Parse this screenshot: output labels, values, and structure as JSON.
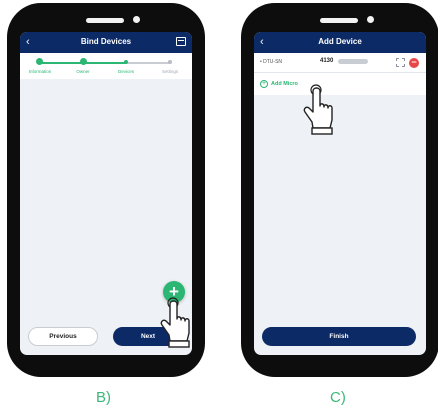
{
  "panel_b": {
    "header_title": "Bind Devices",
    "steps": [
      "Information",
      "Owner",
      "Devices",
      "Settings"
    ],
    "previous_label": "Previous",
    "next_label": "Next",
    "fab_label": "+",
    "caption": "B)"
  },
  "panel_c": {
    "header_title": "Add Device",
    "field_label": "• DTU-SN",
    "field_value": "4130",
    "add_micro_label": "Add Micro",
    "remove_label": "−",
    "finish_label": "Finish",
    "caption": "C)"
  },
  "colors": {
    "header": "#0c2a66",
    "accent_green": "#2bb673",
    "remove_red": "#e8474a",
    "caption_green": "#3cb878"
  },
  "icons": [
    "back-arrow-icon",
    "save-icon",
    "plus-icon",
    "scan-icon",
    "remove-icon",
    "pointing-hand-icon"
  ]
}
